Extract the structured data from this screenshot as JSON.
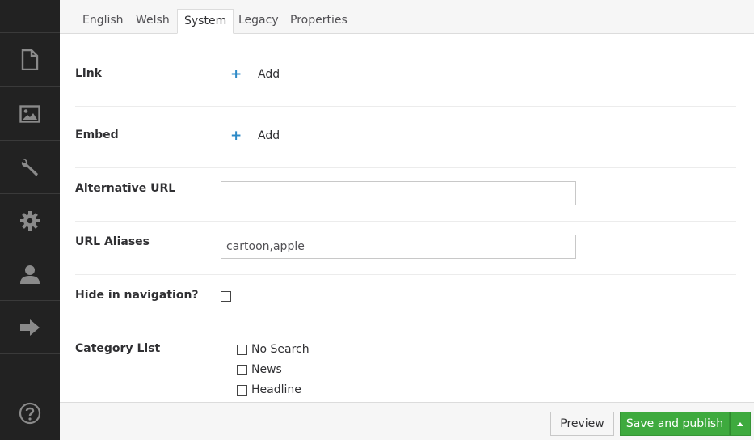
{
  "tabs": [
    {
      "label": "English"
    },
    {
      "label": "Welsh"
    },
    {
      "label": "System",
      "active": true
    },
    {
      "label": "Legacy"
    },
    {
      "label": "Properties"
    }
  ],
  "sidebar": {
    "items": [
      {
        "icon": "document-icon"
      },
      {
        "icon": "image-icon"
      },
      {
        "icon": "wrench-icon"
      },
      {
        "icon": "gear-icon"
      },
      {
        "icon": "user-icon"
      },
      {
        "icon": "arrow-right-icon"
      }
    ],
    "help_icon": "help-icon"
  },
  "fields": {
    "link": {
      "label": "Link",
      "add_label": "Add"
    },
    "embed": {
      "label": "Embed",
      "add_label": "Add"
    },
    "alternative_url": {
      "label": "Alternative URL",
      "value": ""
    },
    "url_aliases": {
      "label": "URL Aliases",
      "value": "cartoon,apple"
    },
    "hide_in_navigation": {
      "label": "Hide in navigation?",
      "checked": false
    },
    "category_list": {
      "label": "Category List",
      "options": [
        {
          "label": "No Search",
          "checked": false
        },
        {
          "label": "News",
          "checked": false
        },
        {
          "label": "Headline",
          "checked": false
        }
      ]
    }
  },
  "footer": {
    "preview_label": "Preview",
    "save_label": "Save and publish"
  },
  "colors": {
    "sidebar_bg": "#222222",
    "primary_green": "#3eaa3e",
    "accent_blue": "#2d8ac7"
  }
}
